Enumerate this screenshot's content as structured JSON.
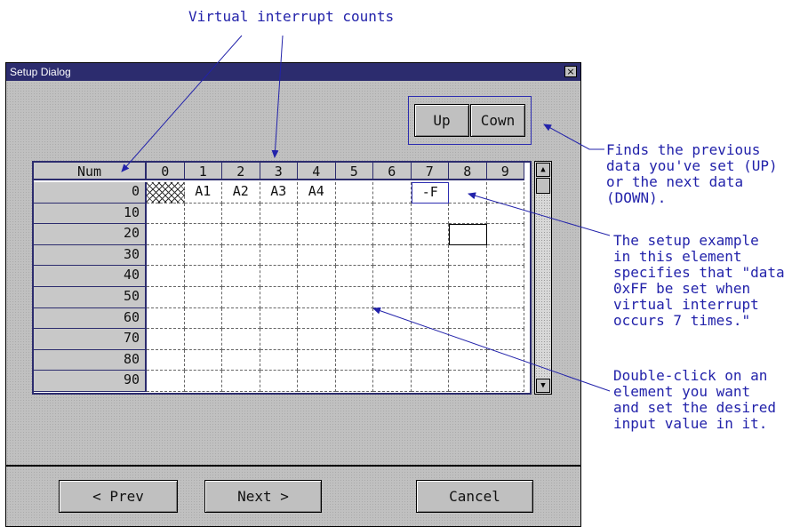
{
  "annotations": {
    "top": "Virtual interrupt counts",
    "updown_note": "Finds the previous\ndata you've set (UP)\nor the next data\n(DOWN).",
    "example_note": "The setup example\nin this element\nspecifies that \"data\n0xFF be set when\nvirtual interrupt\noccurs 7 times.\"",
    "dblclick_note": "Double-click on an\nelement you want\nand set the desired\ninput value in it."
  },
  "dialog": {
    "title": "Setup Dialog",
    "close_glyph": "×",
    "up_label": "Up",
    "down_label": "Cown",
    "prev_label": "< Prev",
    "next_label": "Next >",
    "cancel_label": "Cancel"
  },
  "grid": {
    "corner_label": "Num",
    "columns": [
      "0",
      "1",
      "2",
      "3",
      "4",
      "5",
      "6",
      "7",
      "8",
      "9"
    ],
    "rows": [
      "0",
      "10",
      "20",
      "30",
      "40",
      "50",
      "60",
      "70",
      "80",
      "90"
    ],
    "row0_cells": [
      "",
      "A1",
      "A2",
      "A3",
      "A4",
      "",
      "",
      "-F",
      "",
      ""
    ]
  },
  "scrollbar": {
    "up_glyph": "▲",
    "down_glyph": "▼"
  }
}
